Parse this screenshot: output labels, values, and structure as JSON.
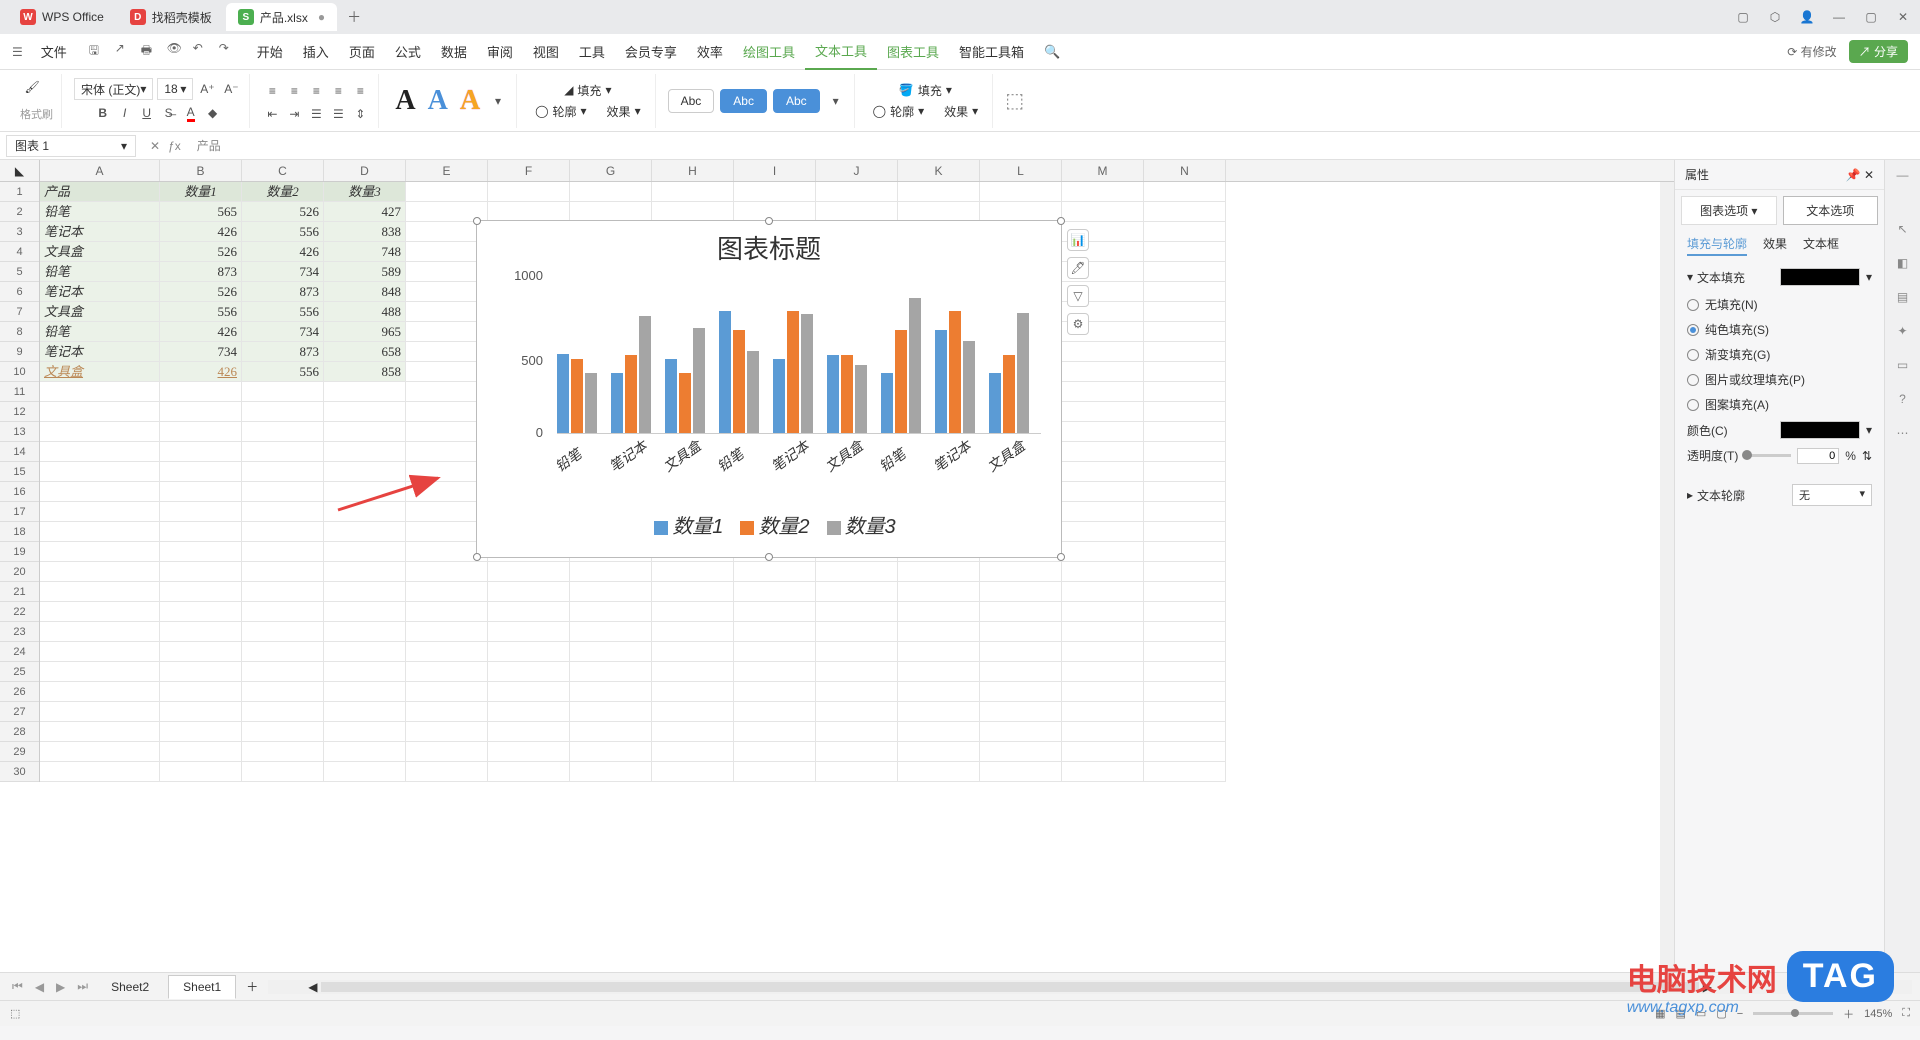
{
  "titlebar": {
    "app": "WPS Office",
    "tabs": [
      {
        "icon": "red",
        "iconText": "D",
        "label": "找稻壳模板"
      },
      {
        "icon": "green",
        "iconText": "S",
        "label": "产品.xlsx",
        "active": true,
        "dirty": "●"
      }
    ]
  },
  "menubar": {
    "file": "文件",
    "items": [
      "开始",
      "插入",
      "页面",
      "公式",
      "数据",
      "审阅",
      "视图",
      "工具",
      "会员专享",
      "效率"
    ],
    "chartTools": [
      "绘图工具",
      "文本工具",
      "图表工具",
      "智能工具箱"
    ],
    "activeTool": "文本工具",
    "modified": "有修改",
    "share": "分享"
  },
  "ribbon": {
    "brush": "格式刷",
    "font": "宋体 (正文)",
    "size": "18",
    "fill": "填充",
    "outline": "轮廓",
    "effect": "效果",
    "abc": "Abc"
  },
  "namebox": "图表 1",
  "formula": "产品",
  "columns": [
    "A",
    "B",
    "C",
    "D",
    "E",
    "F",
    "G",
    "H",
    "I",
    "J",
    "K",
    "L",
    "M",
    "N"
  ],
  "table": {
    "headers": [
      "产品",
      "数量1",
      "数量2",
      "数量3"
    ],
    "rows": [
      [
        "铅笔",
        "565",
        "526",
        "427"
      ],
      [
        "笔记本",
        "426",
        "556",
        "838"
      ],
      [
        "文具盒",
        "526",
        "426",
        "748"
      ],
      [
        "铅笔",
        "873",
        "734",
        "589"
      ],
      [
        "笔记本",
        "526",
        "873",
        "848"
      ],
      [
        "文具盒",
        "556",
        "556",
        "488"
      ],
      [
        "铅笔",
        "426",
        "734",
        "965"
      ],
      [
        "笔记本",
        "734",
        "873",
        "658"
      ],
      [
        "文具盒",
        "426",
        "556",
        "858"
      ]
    ]
  },
  "chart_data": {
    "type": "bar",
    "title": "图表标题",
    "categories": [
      "铅笔",
      "笔记本",
      "文具盒",
      "铅笔",
      "笔记本",
      "文具盒",
      "铅笔",
      "笔记本",
      "文具盒"
    ],
    "series": [
      {
        "name": "数量1",
        "values": [
          565,
          426,
          526,
          873,
          526,
          556,
          426,
          734,
          426
        ]
      },
      {
        "name": "数量2",
        "values": [
          526,
          556,
          426,
          734,
          873,
          556,
          734,
          873,
          556
        ]
      },
      {
        "name": "数量3",
        "values": [
          427,
          838,
          748,
          589,
          848,
          488,
          965,
          658,
          858
        ]
      }
    ],
    "ylim": [
      0,
      1000
    ],
    "yticks": [
      0,
      500,
      1000
    ],
    "colors": {
      "数量1": "#5b9bd5",
      "数量2": "#ed7d31",
      "数量3": "#a5a5a5"
    }
  },
  "rightPanel": {
    "title": "属性",
    "tab1": "图表选项",
    "tab2": "文本选项",
    "sub1": "填充与轮廓",
    "sub2": "效果",
    "sub3": "文本框",
    "sec1": "文本填充",
    "opts": [
      "无填充(N)",
      "纯色填充(S)",
      "渐变填充(G)",
      "图片或纹理填充(P)",
      "图案填充(A)"
    ],
    "selected": 1,
    "colorLabel": "颜色(C)",
    "transLabel": "透明度(T)",
    "transVal": "0",
    "transUnit": "%",
    "sec2": "文本轮廓",
    "none": "无"
  },
  "sheetTabs": {
    "s1": "Sheet2",
    "s2": "Sheet1"
  },
  "statusbar": {
    "zoom": "145%"
  },
  "watermark": {
    "text": "电脑技术网",
    "url": "www.tagxp.com",
    "tag": "TAG"
  }
}
